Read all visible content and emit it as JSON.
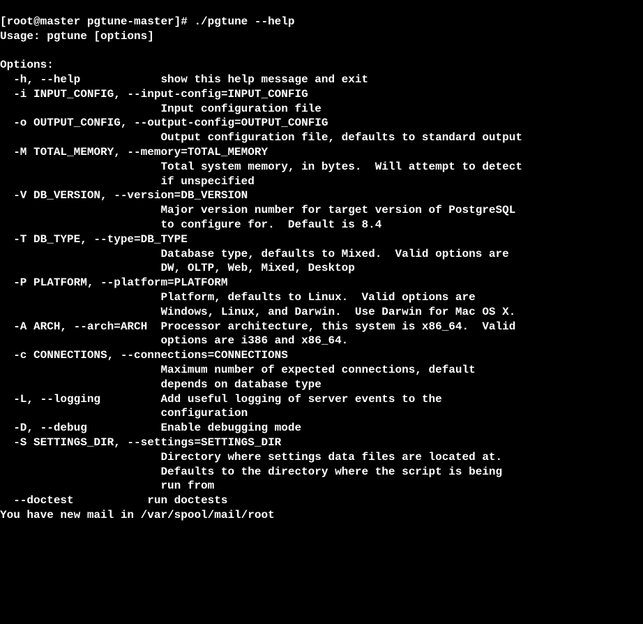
{
  "prompt": "[root@master pgtune-master]# ",
  "command": "./pgtune --help",
  "usage": "Usage: pgtune [options]",
  "options_header": "Options:",
  "options": {
    "help": {
      "flag": "-h, --help",
      "desc": "show this help message and exit"
    },
    "input": {
      "flag": "-i INPUT_CONFIG, --input-config=INPUT_CONFIG",
      "desc": "Input configuration file"
    },
    "output": {
      "flag": "-o OUTPUT_CONFIG, --output-config=OUTPUT_CONFIG",
      "desc": "Output configuration file, defaults to standard output"
    },
    "memory": {
      "flag": "-M TOTAL_MEMORY, --memory=TOTAL_MEMORY",
      "desc1": "Total system memory, in bytes.  Will attempt to detect",
      "desc2": "if unspecified"
    },
    "version": {
      "flag": "-V DB_VERSION, --version=DB_VERSION",
      "desc1": "Major version number for target version of PostgreSQL",
      "desc2": "to configure for.  Default is 8.4"
    },
    "type": {
      "flag": "-T DB_TYPE, --type=DB_TYPE",
      "desc1": "Database type, defaults to Mixed.  Valid options are",
      "desc2": "DW, OLTP, Web, Mixed, Desktop"
    },
    "platform": {
      "flag": "-P PLATFORM, --platform=PLATFORM",
      "desc1": "Platform, defaults to Linux.  Valid options are",
      "desc2": "Windows, Linux, and Darwin.  Use Darwin for Mac OS X."
    },
    "arch": {
      "flag": "-A ARCH, --arch=ARCH",
      "desc1": "Processor architecture, this system is x86_64.  Valid",
      "desc2": "options are i386 and x86_64."
    },
    "connections": {
      "flag": "-c CONNECTIONS, --connections=CONNECTIONS",
      "desc1": "Maximum number of expected connections, default",
      "desc2": "depends on database type"
    },
    "logging": {
      "flag": "-L, --logging",
      "desc1": "Add useful logging of server events to the",
      "desc2": "configuration"
    },
    "debug": {
      "flag": "-D, --debug",
      "desc": "Enable debugging mode"
    },
    "settings": {
      "flag": "-S SETTINGS_DIR, --settings=SETTINGS_DIR",
      "desc1": "Directory where settings data files are located at.",
      "desc2": "Defaults to the directory where the script is being",
      "desc3": "run from"
    },
    "doctest": {
      "flag": "--doctest",
      "desc": "run doctests"
    }
  },
  "mail_notice": "You have new mail in /var/spool/mail/root"
}
